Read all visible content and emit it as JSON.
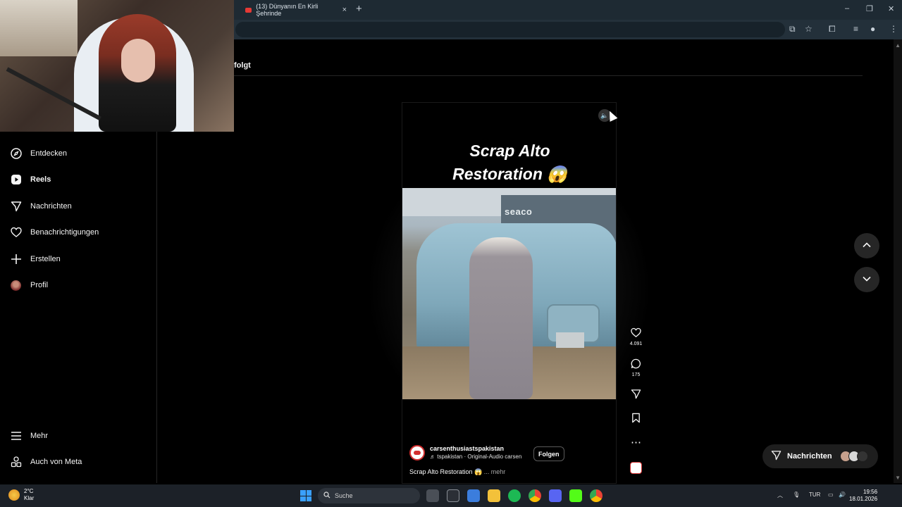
{
  "browser": {
    "tab_title": "(13) Dünyanın En Kirli Şehrinde",
    "tab_close": "×",
    "new_tab": "+",
    "window_controls": [
      "–",
      "❐",
      "✕"
    ]
  },
  "header": {
    "followed_label": "folgt"
  },
  "sidebar": {
    "items": [
      {
        "label": "Entdecken",
        "icon": "compass-icon"
      },
      {
        "label": "Reels",
        "icon": "reels-icon"
      },
      {
        "label": "Nachrichten",
        "icon": "send-icon"
      },
      {
        "label": "Benachrichtigungen",
        "icon": "heart-icon"
      },
      {
        "label": "Erstellen",
        "icon": "plus-icon"
      },
      {
        "label": "Profil",
        "icon": "avatar-icon"
      }
    ],
    "bottom_items": [
      {
        "label": "Mehr",
        "icon": "menu-icon"
      },
      {
        "label": "Auch von Meta",
        "icon": "meta-icon"
      }
    ]
  },
  "reel": {
    "title_line1": "Scrap Alto",
    "title_line2": "Restoration 😱",
    "video_sign": "seaco",
    "username": "carsenthusiastspakistan",
    "audio": "♬ tspakistan · Original-Audio  carsen",
    "follow_label": "Folgen",
    "caption": "Scrap Alto Restoration 😱",
    "caption_more": "... mehr"
  },
  "actions": {
    "likes": "4.091",
    "comments": "175"
  },
  "messages": {
    "label": "Nachrichten"
  },
  "taskbar": {
    "weather_temp": "2°C",
    "weather_desc": "Klar",
    "search_label": "Suche",
    "language": "TUR",
    "time": "19:56",
    "date": "18.01.2026"
  },
  "colors": {
    "accent": "#3aa0ff",
    "brand_red": "#d32f2f",
    "tabbar": "#1e2a33",
    "toolbar": "#23303a"
  }
}
